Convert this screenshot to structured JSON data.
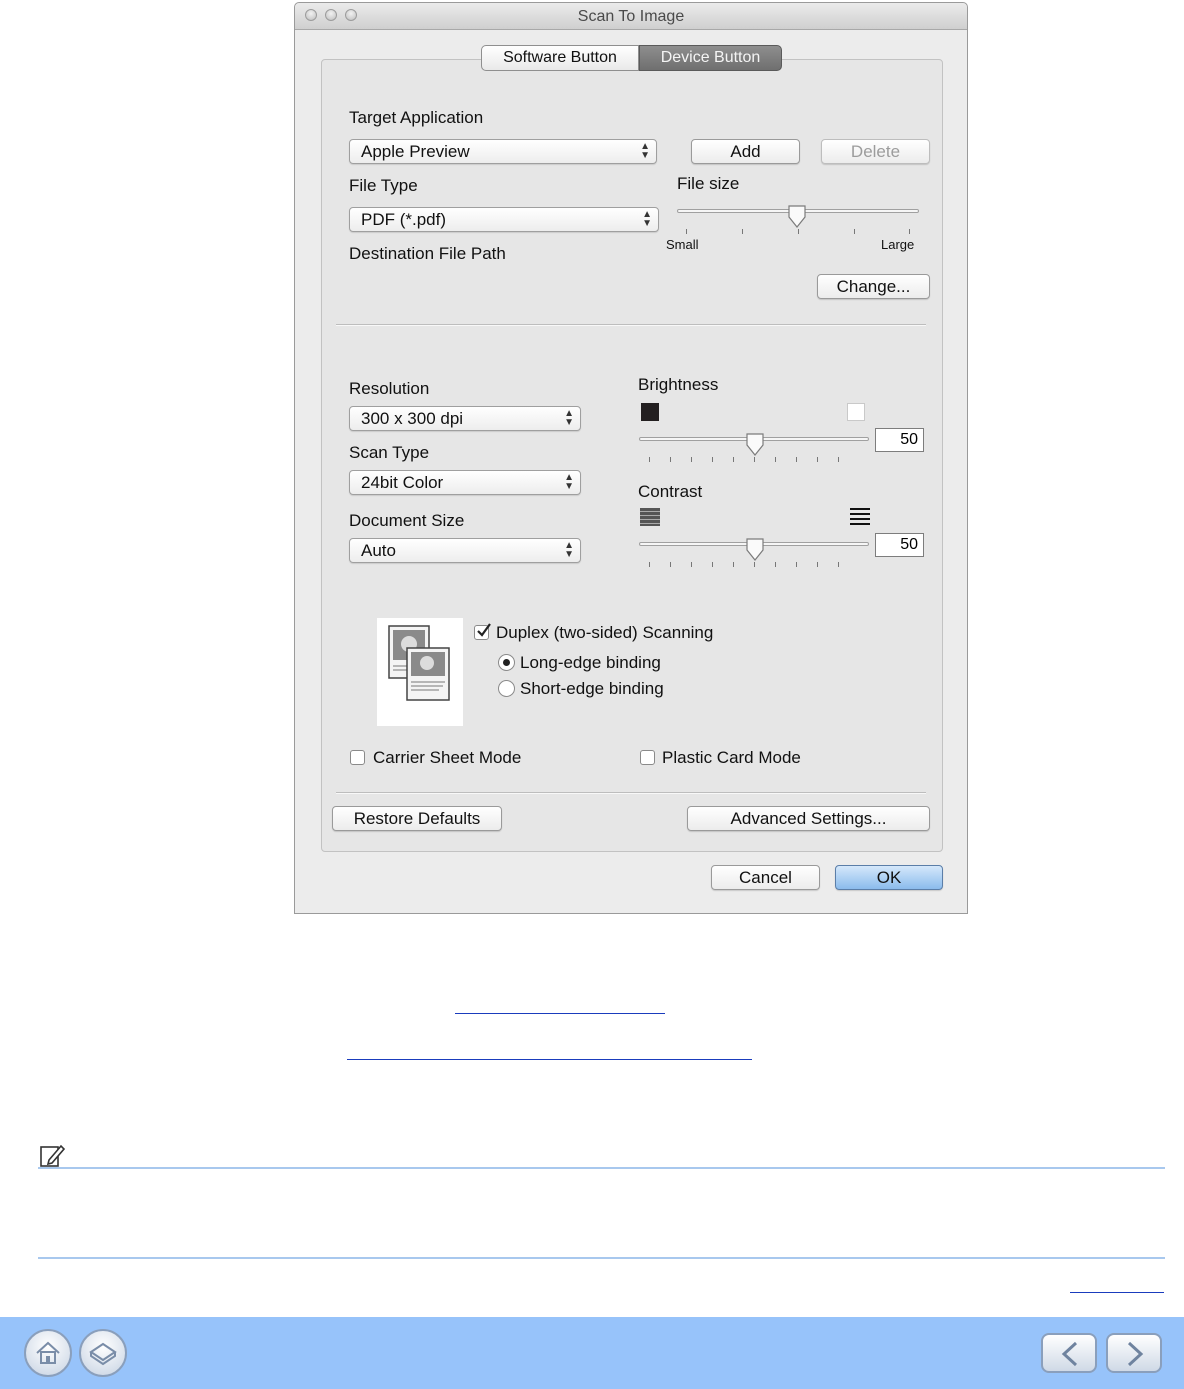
{
  "window": {
    "title": "Scan To Image"
  },
  "tabs": [
    {
      "label": "Software Button",
      "active": false
    },
    {
      "label": "Device Button",
      "active": true
    }
  ],
  "target_application": {
    "label": "Target Application",
    "value": "Apple Preview",
    "add_label": "Add",
    "delete_label": "Delete"
  },
  "file_type": {
    "label": "File Type",
    "value": "PDF (*.pdf)"
  },
  "file_size": {
    "label": "File size",
    "min_label": "Small",
    "max_label": "Large",
    "level": 0.5
  },
  "destination": {
    "label": "Destination File Path",
    "change_label": "Change..."
  },
  "resolution": {
    "label": "Resolution",
    "value": "300 x 300 dpi"
  },
  "scan_type": {
    "label": "Scan Type",
    "value": "24bit Color"
  },
  "document_size": {
    "label": "Document Size",
    "value": "Auto"
  },
  "brightness": {
    "label": "Brightness",
    "value": "50"
  },
  "contrast": {
    "label": "Contrast",
    "value": "50"
  },
  "duplex": {
    "label": "Duplex (two-sided) Scanning",
    "checked": true,
    "long_edge": "Long-edge binding",
    "short_edge": "Short-edge binding",
    "selected": "long_edge"
  },
  "carrier_sheet": {
    "label": "Carrier Sheet Mode",
    "checked": false
  },
  "plastic_card": {
    "label": "Plastic Card Mode",
    "checked": false
  },
  "buttons": {
    "restore": "Restore Defaults",
    "advanced": "Advanced Settings...",
    "cancel": "Cancel",
    "ok": "OK"
  },
  "colors": {
    "footer": "#97c3fa",
    "note_rule": "#a8c8ee",
    "link": "#1a3cbd"
  },
  "icons": {
    "note": "pencil-note-icon",
    "home": "home-icon",
    "toc": "book-icon",
    "prev": "chevron-left-icon",
    "next": "chevron-right-icon"
  }
}
